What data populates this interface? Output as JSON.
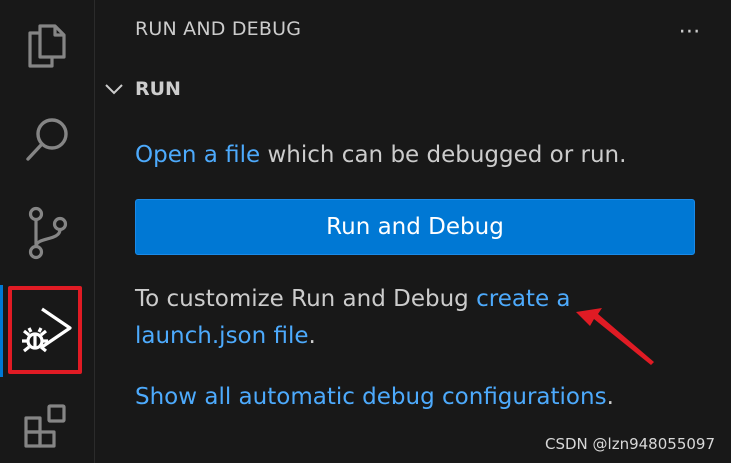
{
  "activity_bar": {
    "items": [
      {
        "name": "explorer",
        "icon": "files-icon"
      },
      {
        "name": "search",
        "icon": "search-icon"
      },
      {
        "name": "source-control",
        "icon": "source-control-icon"
      },
      {
        "name": "run-and-debug",
        "icon": "run-debug-icon",
        "active": true
      },
      {
        "name": "extensions",
        "icon": "extensions-icon"
      }
    ],
    "active_color": "#0078d4",
    "highlight_color": "#e01b24"
  },
  "sidebar": {
    "title": "RUN AND DEBUG",
    "more_actions": "⋯",
    "section": {
      "title": "RUN",
      "expanded": true
    },
    "open_file_link": "Open a file",
    "open_file_text": " which can be debugged or run.",
    "run_button_label": "Run and Debug",
    "customize_text": "To customize Run and Debug ",
    "create_link_1": "create a",
    "create_link_2": "launch.json file",
    "customize_end": ".",
    "show_all_link": "Show all automatic debug configurations",
    "show_all_end": "."
  },
  "colors": {
    "background": "#181818",
    "text": "#cccccc",
    "link": "#4daafc",
    "button": "#0078d4",
    "annotation_arrow": "#e01b24"
  },
  "watermark": "CSDN @lzn948055097"
}
